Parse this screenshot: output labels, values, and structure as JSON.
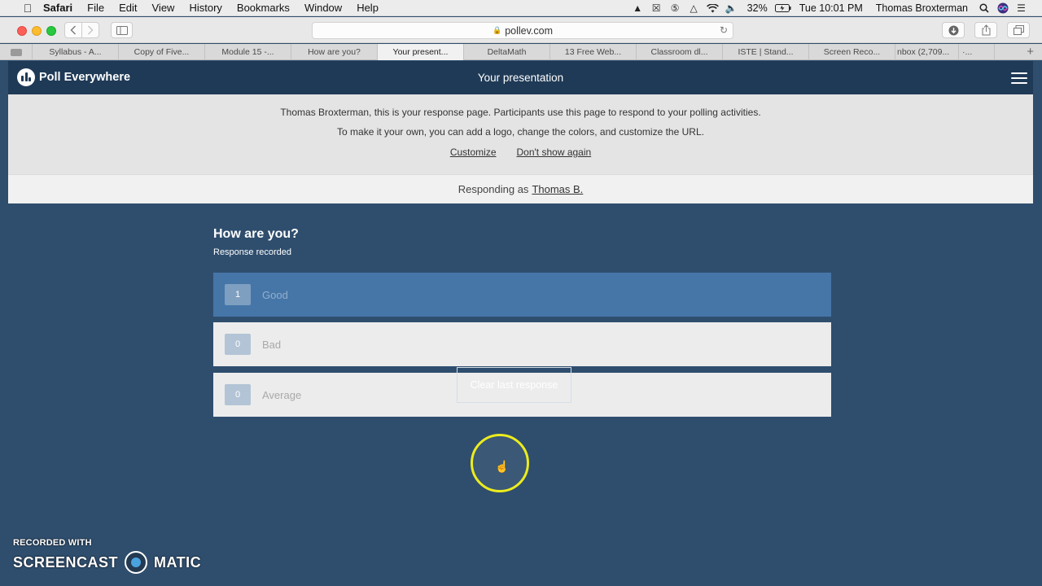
{
  "menubar": {
    "app": "Safari",
    "items": [
      "File",
      "Edit",
      "View",
      "History",
      "Bookmarks",
      "Window",
      "Help"
    ],
    "battery": "32%",
    "clock": "Tue 10:01 PM",
    "user": "Thomas Broxterman",
    "status_icons": [
      "drive-icon",
      "x-icon",
      "five-icon",
      "vpn-icon",
      "wifi-icon",
      "volume-icon",
      "battery-icon",
      "search-icon",
      "siri-icon",
      "list-icon"
    ]
  },
  "toolbar": {
    "url": "pollev.com"
  },
  "tabs": [
    {
      "label": "Syllabus - A..."
    },
    {
      "label": "Copy of Five..."
    },
    {
      "label": "Module 15 -..."
    },
    {
      "label": "How are you?"
    },
    {
      "label": "Your present..."
    },
    {
      "label": "DeltaMath"
    },
    {
      "label": "13 Free Web..."
    },
    {
      "label": "Classroom dl..."
    },
    {
      "label": "ISTE | Stand..."
    },
    {
      "label": "Screen Reco..."
    },
    {
      "label": "nbox (2,709..."
    },
    {
      "label": "·..."
    }
  ],
  "app": {
    "brand": "Poll Everywhere",
    "title": "Your presentation"
  },
  "notice": {
    "line1": "Thomas Broxterman, this is your response page. Participants use this page to respond to your polling activities.",
    "line2": "To make it your own, you can add a logo, change the colors, and customize the URL.",
    "customize": "Customize",
    "dont_show": "Don't show again"
  },
  "responding": {
    "prefix": "Responding as",
    "name": "Thomas B."
  },
  "poll": {
    "question": "How are you?",
    "status": "Response recorded",
    "options": [
      {
        "count": "1",
        "label": "Good",
        "selected": true
      },
      {
        "count": "0",
        "label": "Bad",
        "selected": false
      },
      {
        "count": "0",
        "label": "Average",
        "selected": false
      }
    ],
    "clear_button": "Clear last response"
  },
  "watermark": {
    "line1": "RECORDED WITH",
    "left": "SCREENCAST",
    "right": "MATIC"
  },
  "colors": {
    "page_bg": "#2f4e6e",
    "header_bg": "#1f3a56",
    "selected_option": "#4676a8",
    "cursor_highlight": "#ecec1e"
  }
}
